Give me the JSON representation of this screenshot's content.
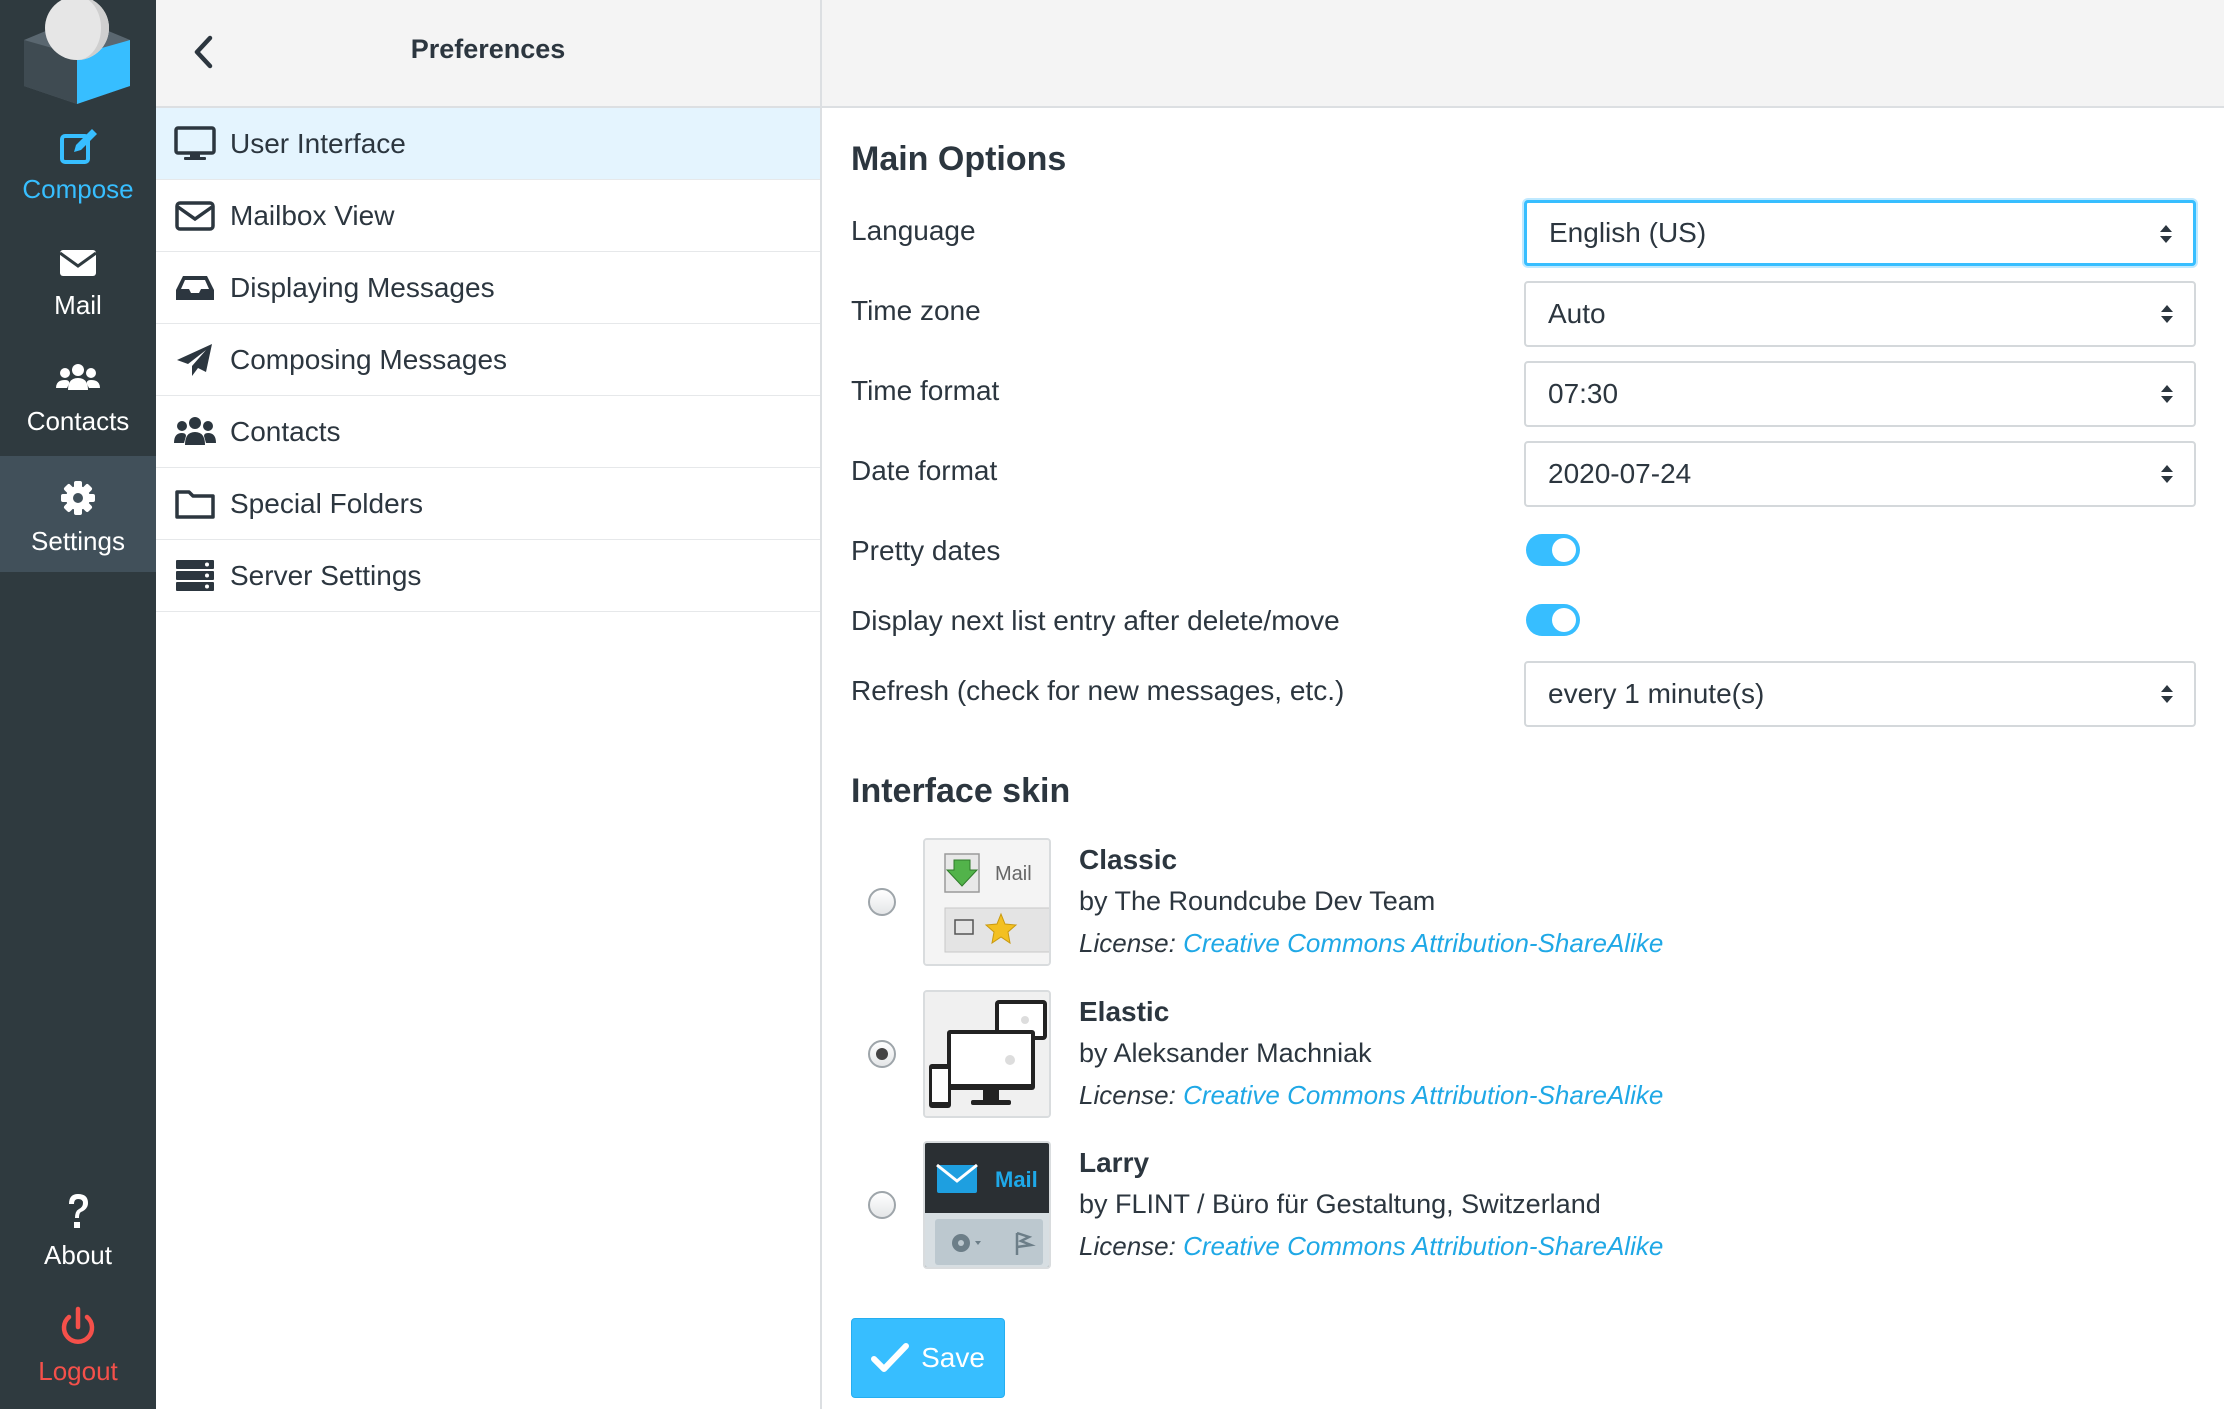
{
  "nav": {
    "compose": "Compose",
    "mail": "Mail",
    "contacts": "Contacts",
    "settings": "Settings",
    "about": "About",
    "logout": "Logout"
  },
  "prefs": {
    "title": "Preferences",
    "items": [
      {
        "label": "User Interface",
        "icon": "monitor-icon"
      },
      {
        "label": "Mailbox View",
        "icon": "envelope-icon"
      },
      {
        "label": "Displaying Messages",
        "icon": "inbox-icon"
      },
      {
        "label": "Composing Messages",
        "icon": "paper-plane-icon"
      },
      {
        "label": "Contacts",
        "icon": "users-icon"
      },
      {
        "label": "Special Folders",
        "icon": "folder-icon"
      },
      {
        "label": "Server Settings",
        "icon": "server-icon"
      }
    ]
  },
  "main": {
    "heading": "Main Options",
    "language_label": "Language",
    "language_value": "English (US)",
    "timezone_label": "Time zone",
    "timezone_value": "Auto",
    "timeformat_label": "Time format",
    "timeformat_value": "07:30",
    "dateformat_label": "Date format",
    "dateformat_value": "2020-07-24",
    "prettydates_label": "Pretty dates",
    "prettydates_on": true,
    "nextentry_label": "Display next list entry after delete/move",
    "nextentry_on": true,
    "refresh_label": "Refresh (check for new messages, etc.)",
    "refresh_value": "every 1 minute(s)"
  },
  "skins": {
    "heading": "Interface skin",
    "license_prefix": "License:",
    "items": [
      {
        "name": "Classic",
        "author": "by The Roundcube Dev Team",
        "license": "Creative Commons Attribution-ShareAlike",
        "selected": false
      },
      {
        "name": "Elastic",
        "author": "by Aleksander Machniak",
        "license": "Creative Commons Attribution-ShareAlike",
        "selected": true
      },
      {
        "name": "Larry",
        "author": "by FLINT / Büro für Gestaltung, Switzerland",
        "license": "Creative Commons Attribution-ShareAlike",
        "selected": false
      }
    ],
    "thumb_text": "Mail"
  },
  "save_label": "Save",
  "colors": {
    "accent": "#37beff",
    "sidebar": "#2f3a3f",
    "logout": "#f5504a"
  }
}
